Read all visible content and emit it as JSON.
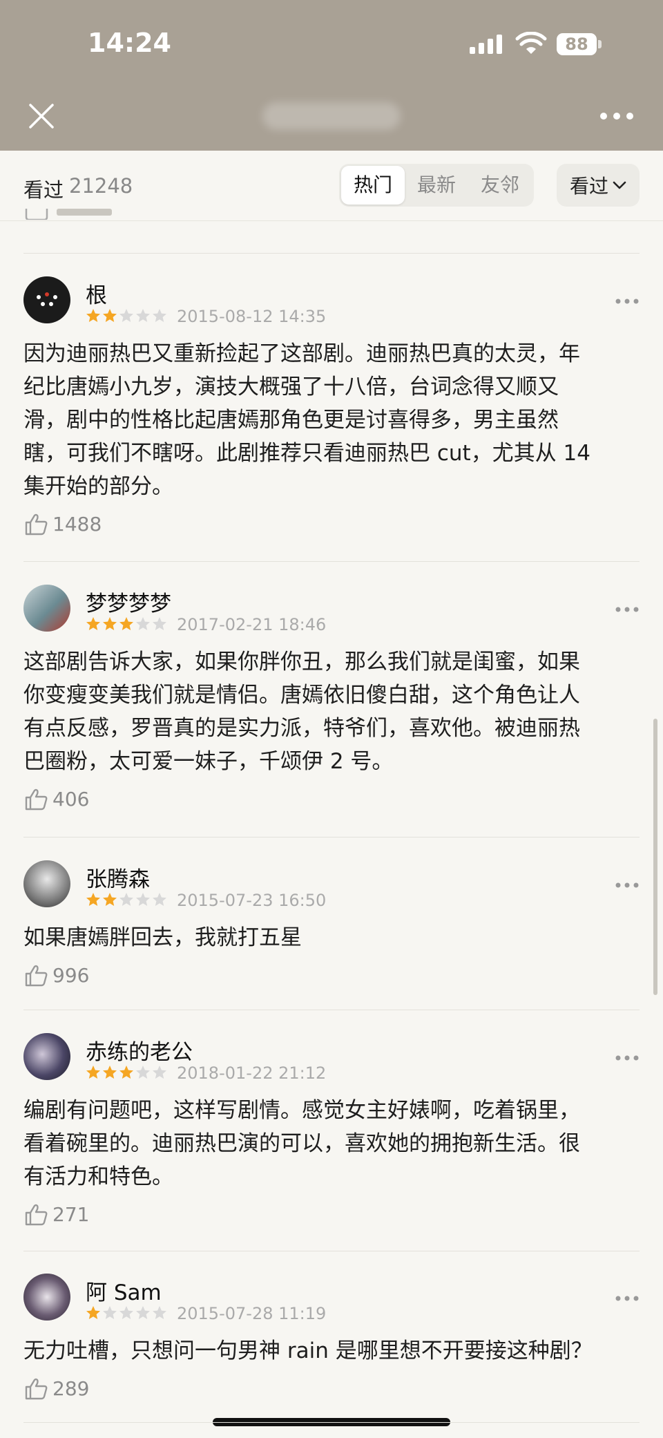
{
  "status": {
    "time": "14:24",
    "battery": "88"
  },
  "header": {
    "close_icon": "close-icon",
    "more_icon": "more-icon"
  },
  "filter": {
    "watched_label": "看过",
    "watched_count": "21248",
    "tabs": [
      "热门",
      "最新",
      "友邻"
    ],
    "selected_tab": "热门",
    "dropdown_label": "看过"
  },
  "colors": {
    "star_filled": "#f5a623",
    "star_empty": "#d8d8d8",
    "topbar": "#a9a195"
  },
  "reviews": [
    {
      "name": "根",
      "rating": 2,
      "date": "2015-08-12 14:35",
      "lines": [
        "因为迪丽热巴又重新捡起了这部剧。迪丽热巴真的太灵，年",
        "纪比唐嫣小九岁，演技大概强了十八倍，台词念得又顺又",
        "滑，剧中的性格比起唐嫣那角色更是讨喜得多，男主虽然",
        "瞎，可我们不瞎呀。此剧推荐只看迪丽热巴 cut，尤其从 14",
        "集开始的部分。"
      ],
      "likes": "1488"
    },
    {
      "name": "梦梦梦梦",
      "rating": 3,
      "date": "2017-02-21 18:46",
      "lines": [
        "这部剧告诉大家，如果你胖你丑，那么我们就是闺蜜，如果",
        "你变瘦变美我们就是情侣。唐嫣依旧傻白甜，这个角色让人",
        "有点反感，罗晋真的是实力派，特爷们，喜欢他。被迪丽热",
        "巴圈粉，太可爱一妹子，千颂伊 2 号。"
      ],
      "likes": "406"
    },
    {
      "name": "张腾森",
      "rating": 2,
      "date": "2015-07-23 16:50",
      "lines": [
        "如果唐嫣胖回去，我就打五星"
      ],
      "likes": "996"
    },
    {
      "name": "赤练的老公",
      "rating": 3,
      "date": "2018-01-22 21:12",
      "lines": [
        "编剧有问题吧，这样写剧情。感觉女主好婊啊，吃着锅里，",
        "看着碗里的。迪丽热巴演的可以，喜欢她的拥抱新生活。很",
        "有活力和特色。"
      ],
      "likes": "271"
    },
    {
      "name": "阿 Sam",
      "rating": 1,
      "date": "2015-07-28 11:19",
      "lines": [
        "无力吐槽，只想问一句男神 rain 是哪里想不开要接这种剧？"
      ],
      "likes": "289"
    }
  ]
}
